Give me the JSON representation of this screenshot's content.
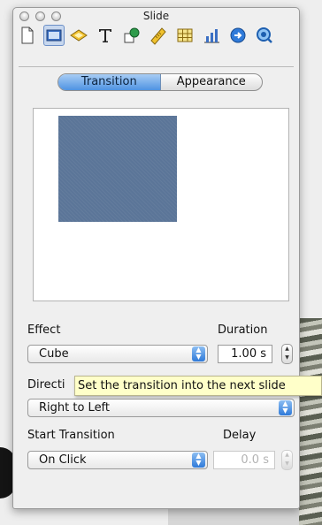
{
  "window": {
    "title": "Slide"
  },
  "toolbar": {
    "tools": [
      {
        "icon": "document-icon"
      },
      {
        "icon": "slide-icon",
        "selected": true
      },
      {
        "icon": "build-icon"
      },
      {
        "icon": "text-icon"
      },
      {
        "icon": "graphic-icon"
      },
      {
        "icon": "metrics-icon"
      },
      {
        "icon": "table-icon"
      },
      {
        "icon": "chart-icon"
      },
      {
        "icon": "hyperlink-icon"
      },
      {
        "icon": "quicktime-icon"
      }
    ]
  },
  "tabs": {
    "transition": "Transition",
    "appearance": "Appearance",
    "active": "transition"
  },
  "labels": {
    "effect": "Effect",
    "duration": "Duration",
    "direction": "Directi",
    "start_transition": "Start Transition",
    "delay": "Delay"
  },
  "controls": {
    "effect_value": "Cube",
    "duration_value": "1.00 s",
    "direction_value": "Right to Left",
    "start_value": "On Click",
    "delay_value": "0.0 s"
  },
  "tooltip": {
    "text": "Set the transition into the next slide"
  },
  "colors": {
    "accent": "#4f93e2",
    "thumbnail": "#5b7598",
    "tooltip_bg": "#ffffc9"
  }
}
